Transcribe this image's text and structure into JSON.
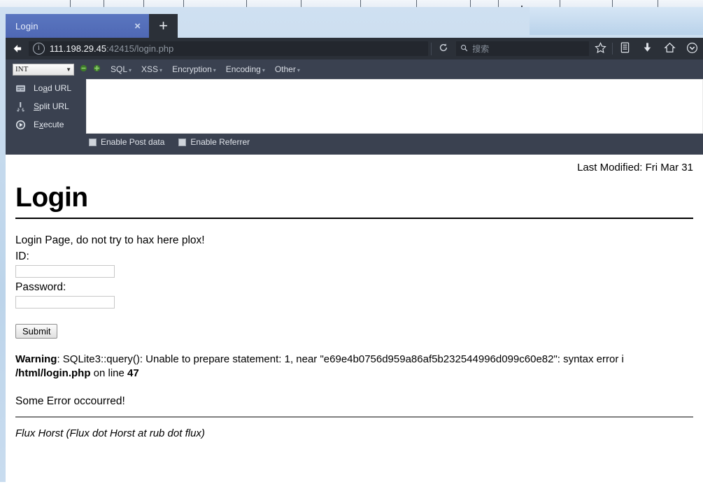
{
  "browser": {
    "tab": {
      "title": "Login",
      "close_label": "×"
    },
    "new_tab_label": "+",
    "back_icon": "←",
    "url": {
      "host": "111.198.29.45",
      "rest": ":42415/login.php",
      "identity_icon": "i"
    },
    "reload_icon": "⟳",
    "search": {
      "icon": "ὐD",
      "placeholder": "搜索"
    },
    "icons": {
      "bookmark_star": "☆",
      "library": "Ὅ3",
      "downloads": "↓",
      "home": "⌂",
      "overflow_chevron": "⌄"
    }
  },
  "hackbar": {
    "type_select": {
      "value": "INT",
      "arrow": "▼"
    },
    "nav_prev_icon": "◀",
    "nav_next_icon": "✶",
    "menus": [
      {
        "label": "SQL",
        "caret": "▾"
      },
      {
        "label": "XSS",
        "caret": "▾"
      },
      {
        "label": "Encryption",
        "caret": "▾"
      },
      {
        "label": "Encoding",
        "caret": "▾"
      },
      {
        "label": "Other",
        "caret": "▾"
      }
    ],
    "actions": [
      {
        "icon": "⌨",
        "pre": "Lo",
        "key": "a",
        "post": "d URL"
      },
      {
        "icon": "✂",
        "pre": "",
        "key": "S",
        "post": "plit URL"
      },
      {
        "icon": "▶",
        "pre": "E",
        "key": "x",
        "post": "ecute"
      }
    ],
    "textarea_value": "",
    "checkboxes": [
      {
        "label": "Enable Post data",
        "checked": false
      },
      {
        "label": "Enable Referrer",
        "checked": false
      }
    ]
  },
  "page": {
    "last_modified": "Last Modified: Fri Mar 31",
    "title": "Login",
    "intro": "Login Page, do not try to hax here plox!",
    "id_label": "ID:",
    "id_value": "",
    "password_label": "Password:",
    "password_value": "",
    "submit_label": "Submit",
    "warning": {
      "label": "Warning",
      "body_1": ": SQLite3::query(): Unable to prepare statement: 1, near \"e69e4b0756d959a86af5b232544996d099c60e82\": syntax error i",
      "path": "/html/login.php",
      "on_line_text": " on line ",
      "line_number": "47"
    },
    "error_text": "Some Error occourred!",
    "footer_credit": "Flux Horst (Flux dot Horst at rub dot flux)"
  },
  "colors": {
    "chrome_dark": "#2b3038",
    "hackbar_bg": "#3a4150",
    "tab_active": "#4f68b4",
    "accent_green": "#4c9c2e"
  }
}
